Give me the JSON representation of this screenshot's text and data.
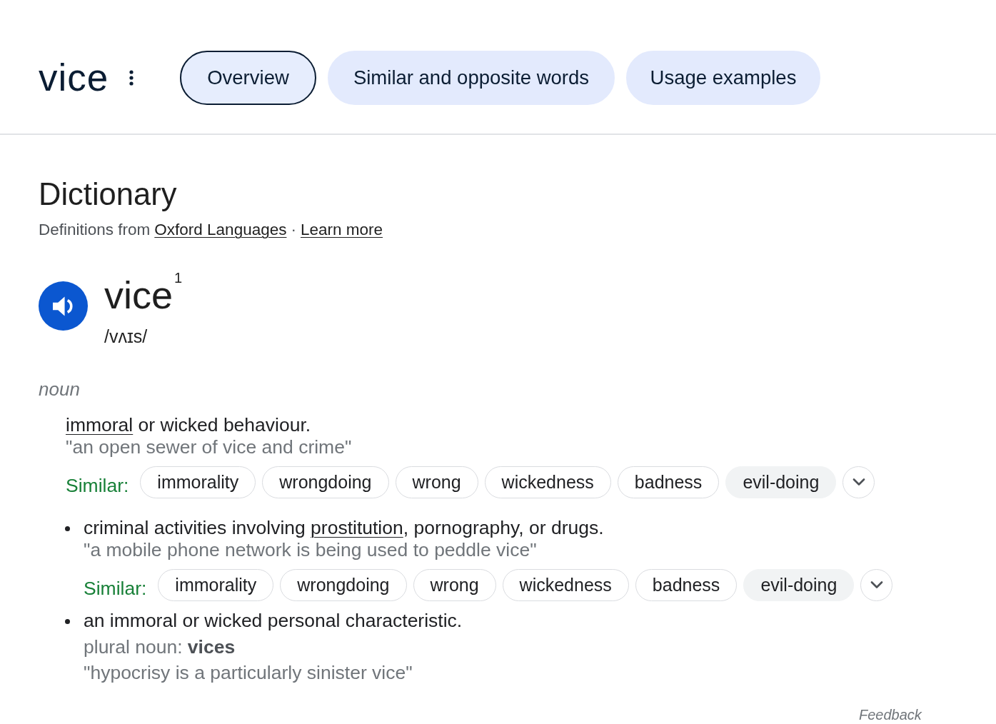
{
  "header": {
    "title": "vice"
  },
  "tabs": [
    {
      "label": "Overview",
      "selected": true
    },
    {
      "label": "Similar and opposite words",
      "selected": false
    },
    {
      "label": "Usage examples",
      "selected": false
    }
  ],
  "dictionary": {
    "heading": "Dictionary",
    "source_prefix": "Definitions from",
    "source_link": "Oxford Languages",
    "separator": "·",
    "learn_more": "Learn more"
  },
  "entry": {
    "word": "vice",
    "superscript": "1",
    "pronunciation": "/vʌɪs/",
    "part_of_speech": "noun",
    "senses": [
      {
        "kind": "primary",
        "definition": [
          {
            "text": "immoral",
            "link": true
          },
          {
            "text": " or wicked behaviour.",
            "link": false
          }
        ],
        "example": "\"an open sewer of vice and crime\"",
        "similar": {
          "label": "Similar:",
          "expanded": false,
          "words": [
            {
              "word": "immorality",
              "highlighted": false
            },
            {
              "word": "wrongdoing",
              "highlighted": false
            },
            {
              "word": "wrong",
              "highlighted": false
            },
            {
              "word": "wickedness",
              "highlighted": false
            },
            {
              "word": "badness",
              "highlighted": false
            },
            {
              "word": "evil-doing",
              "highlighted": true
            }
          ]
        }
      },
      {
        "kind": "bullet",
        "definition": [
          {
            "text": "criminal activities involving ",
            "link": false
          },
          {
            "text": "prostitution",
            "link": true
          },
          {
            "text": ", pornography, or drugs.",
            "link": false
          }
        ],
        "example": "\"a mobile phone network is being used to peddle vice\"",
        "similar": {
          "label": "Similar:",
          "expanded": false,
          "words": [
            {
              "word": "immorality",
              "highlighted": false
            },
            {
              "word": "wrongdoing",
              "highlighted": false
            },
            {
              "word": "wrong",
              "highlighted": false
            },
            {
              "word": "wickedness",
              "highlighted": false
            },
            {
              "word": "badness",
              "highlighted": false
            },
            {
              "word": "evil-doing",
              "highlighted": true
            }
          ]
        }
      },
      {
        "kind": "bullet",
        "definition": [
          {
            "text": "an immoral or wicked personal characteristic.",
            "link": false
          }
        ],
        "inflection": "plural noun: **vices**",
        "example": "\"hypocrisy is a particularly sinister vice\""
      }
    ]
  },
  "feedback": "Feedback"
}
